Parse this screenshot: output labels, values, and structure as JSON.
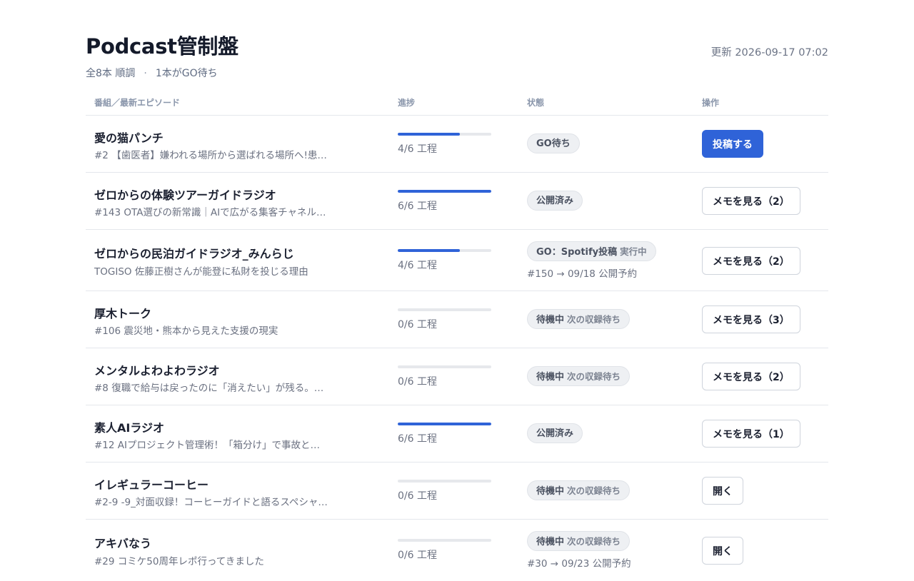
{
  "header": {
    "title": "Podcast管制盤",
    "summary_count": "全8本 順調",
    "summary_dot": "·",
    "summary_go": "1本がGO待ち",
    "updated": "更新 2026-09-17 07:02"
  },
  "table": {
    "columns": [
      "番組／最新エピソード",
      "進捗",
      "状態",
      "操作"
    ],
    "rows": [
      {
        "show": "愛の猫パンチ",
        "episode": "#2 【歯医者】嫌われる場所から選ばれる場所へ!患…",
        "progress_fraction": 0.667,
        "progress_label": "4/6 工程",
        "status": "GO待ち",
        "status_sub": "",
        "schedule": "",
        "action": "投稿する",
        "action_style": "primary"
      },
      {
        "show": "ゼロからの体験ツアーガイドラジオ",
        "episode": "#143 OTA選びの新常識｜AIで広がる集客チャネル…",
        "progress_fraction": 1.0,
        "progress_label": "6/6 工程",
        "status": "公開済み",
        "status_sub": "",
        "schedule": "",
        "action": "メモを見る（2）",
        "action_style": "default"
      },
      {
        "show": "ゼロからの民泊ガイドラジオ_みんらじ",
        "episode": "TOGISO 佐藤正樹さんが能登に私財を投じる理由",
        "progress_fraction": 0.667,
        "progress_label": "4/6 工程",
        "status": "GO：Spotify投稿",
        "status_sub": "実行中",
        "schedule": "#150 → 09/18 公開予約",
        "action": "メモを見る（2）",
        "action_style": "default"
      },
      {
        "show": "厚木トーク",
        "episode": "#106 震災地・熊本から見えた支援の現実",
        "progress_fraction": 0,
        "progress_label": "0/6 工程",
        "status": "待機中",
        "status_sub": "次の収録待ち",
        "schedule": "",
        "action": "メモを見る（3）",
        "action_style": "default"
      },
      {
        "show": "メンタルよわよわラジオ",
        "episode": "#8 復職で給与は戻ったのに「消えたい」が残る。…",
        "progress_fraction": 0,
        "progress_label": "0/6 工程",
        "status": "待機中",
        "status_sub": "次の収録待ち",
        "schedule": "",
        "action": "メモを見る（2）",
        "action_style": "default"
      },
      {
        "show": "素人AIラジオ",
        "episode": "#12 AIプロジェクト管理術！「箱分け」で事故と…",
        "progress_fraction": 1.0,
        "progress_label": "6/6 工程",
        "status": "公開済み",
        "status_sub": "",
        "schedule": "",
        "action": "メモを見る（1）",
        "action_style": "default"
      },
      {
        "show": "イレギュラーコーヒー",
        "episode": "#2-9 -9_対面収録！コーヒーガイドと語るスペシャ…",
        "progress_fraction": 0,
        "progress_label": "0/6 工程",
        "status": "待機中",
        "status_sub": "次の収録待ち",
        "schedule": "",
        "action": "開く",
        "action_style": "default"
      },
      {
        "show": "アキバなう",
        "episode": "#29 コミケ50周年レポ行ってきました",
        "progress_fraction": 0,
        "progress_label": "0/6 工程",
        "status": "待機中",
        "status_sub": "次の収録待ち",
        "schedule": "#30 → 09/23 公開予約",
        "action": "開く",
        "action_style": "default"
      }
    ]
  },
  "colors": {
    "accent": "#2f63d8",
    "chip_bg": "#eef0f3",
    "border": "#e4e7ec"
  }
}
